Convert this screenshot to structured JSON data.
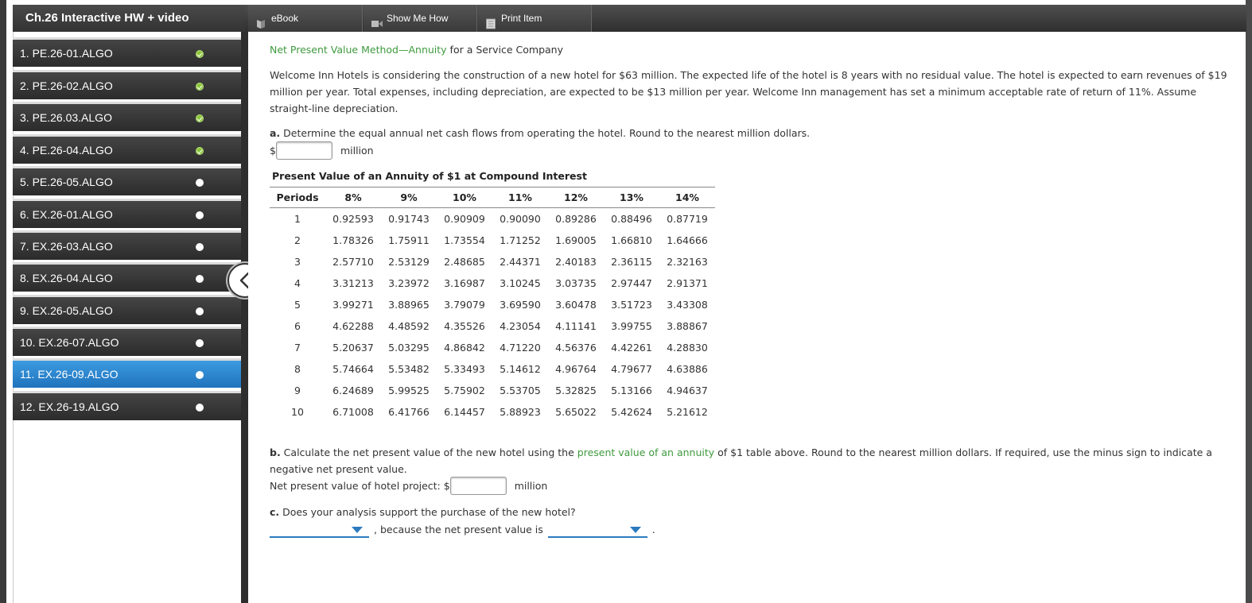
{
  "app": {
    "course_title": "Ch.26 Interactive HW + video",
    "toolbar": {
      "ebook": "eBook",
      "show_me_how": "Show Me How",
      "print_item": "Print Item"
    }
  },
  "sidebar": {
    "items": [
      {
        "label": "1. PE.26-01.ALGO",
        "status": "done"
      },
      {
        "label": "2. PE.26-02.ALGO",
        "status": "done"
      },
      {
        "label": "3. PE.26.03.ALGO",
        "status": "done"
      },
      {
        "label": "4. PE.26-04.ALGO",
        "status": "done"
      },
      {
        "label": "5. PE.26-05.ALGO",
        "status": "open"
      },
      {
        "label": "6. EX.26-01.ALGO",
        "status": "open"
      },
      {
        "label": "7. EX.26-03.ALGO",
        "status": "open"
      },
      {
        "label": "8. EX.26-04.ALGO",
        "status": "open"
      },
      {
        "label": "9. EX.26-05.ALGO",
        "status": "open"
      },
      {
        "label": "10. EX.26-07.ALGO",
        "status": "open"
      },
      {
        "label": "11. EX.26-09.ALGO",
        "status": "active"
      },
      {
        "label": "12. EX.26-19.ALGO",
        "status": "open"
      }
    ]
  },
  "problem": {
    "title_link1": "Net Present Value Method",
    "title_dash": "—",
    "title_link2": "Annuity",
    "title_rest": " for a Service Company",
    "paragraph": "Welcome Inn Hotels is considering the construction of a new hotel for $63 million. The expected life of the hotel is 8 years with no residual value. The hotel is expected to earn revenues of $19 million per year. Total expenses, including depreciation, are expected to be $13 million per year. Welcome Inn management has set a minimum acceptable rate of return of 11%. Assume straight-line depreciation.",
    "part_a_letter": "a.",
    "part_a_text": " Determine the equal annual net cash flows from operating the hotel. Round to the nearest million dollars.",
    "dollar": "$",
    "million": "million",
    "table_title": "Present Value of an Annuity of $1 at Compound Interest",
    "table": {
      "headers": [
        "Periods",
        "8%",
        "9%",
        "10%",
        "11%",
        "12%",
        "13%",
        "14%"
      ],
      "rows": [
        [
          "1",
          "0.92593",
          "0.91743",
          "0.90909",
          "0.90090",
          "0.89286",
          "0.88496",
          "0.87719"
        ],
        [
          "2",
          "1.78326",
          "1.75911",
          "1.73554",
          "1.71252",
          "1.69005",
          "1.66810",
          "1.64666"
        ],
        [
          "3",
          "2.57710",
          "2.53129",
          "2.48685",
          "2.44371",
          "2.40183",
          "2.36115",
          "2.32163"
        ],
        [
          "4",
          "3.31213",
          "3.23972",
          "3.16987",
          "3.10245",
          "3.03735",
          "2.97447",
          "2.91371"
        ],
        [
          "5",
          "3.99271",
          "3.88965",
          "3.79079",
          "3.69590",
          "3.60478",
          "3.51723",
          "3.43308"
        ],
        [
          "6",
          "4.62288",
          "4.48592",
          "4.35526",
          "4.23054",
          "4.11141",
          "3.99755",
          "3.88867"
        ],
        [
          "7",
          "5.20637",
          "5.03295",
          "4.86842",
          "4.71220",
          "4.56376",
          "4.42261",
          "4.28830"
        ],
        [
          "8",
          "5.74664",
          "5.53482",
          "5.33493",
          "5.14612",
          "4.96764",
          "4.79677",
          "4.63886"
        ],
        [
          "9",
          "6.24689",
          "5.99525",
          "5.75902",
          "5.53705",
          "5.32825",
          "5.13166",
          "4.94637"
        ],
        [
          "10",
          "6.71008",
          "6.41766",
          "6.14457",
          "5.88923",
          "5.65022",
          "5.42624",
          "5.21612"
        ]
      ]
    },
    "part_b_letter": "b.",
    "part_b_text1": " Calculate the net present value of the new hotel using the ",
    "part_b_link": "present value of an annuity",
    "part_b_text2": " of $1 table above. Round to the nearest million dollars. If required, use the minus sign to indicate a negative net present value.",
    "part_b_label": "Net present value of hotel project: $",
    "part_c_letter": "c.",
    "part_c_text": " Does your analysis support the purchase of the new hotel?",
    "part_c_between": ", because the net present value is",
    "part_c_end": "."
  },
  "colors": {
    "link_green": "#3f9a3f",
    "active_blue": "#2b86d4",
    "dropdown_blue": "#2c7bbf",
    "done_green": "#8cc63e"
  }
}
